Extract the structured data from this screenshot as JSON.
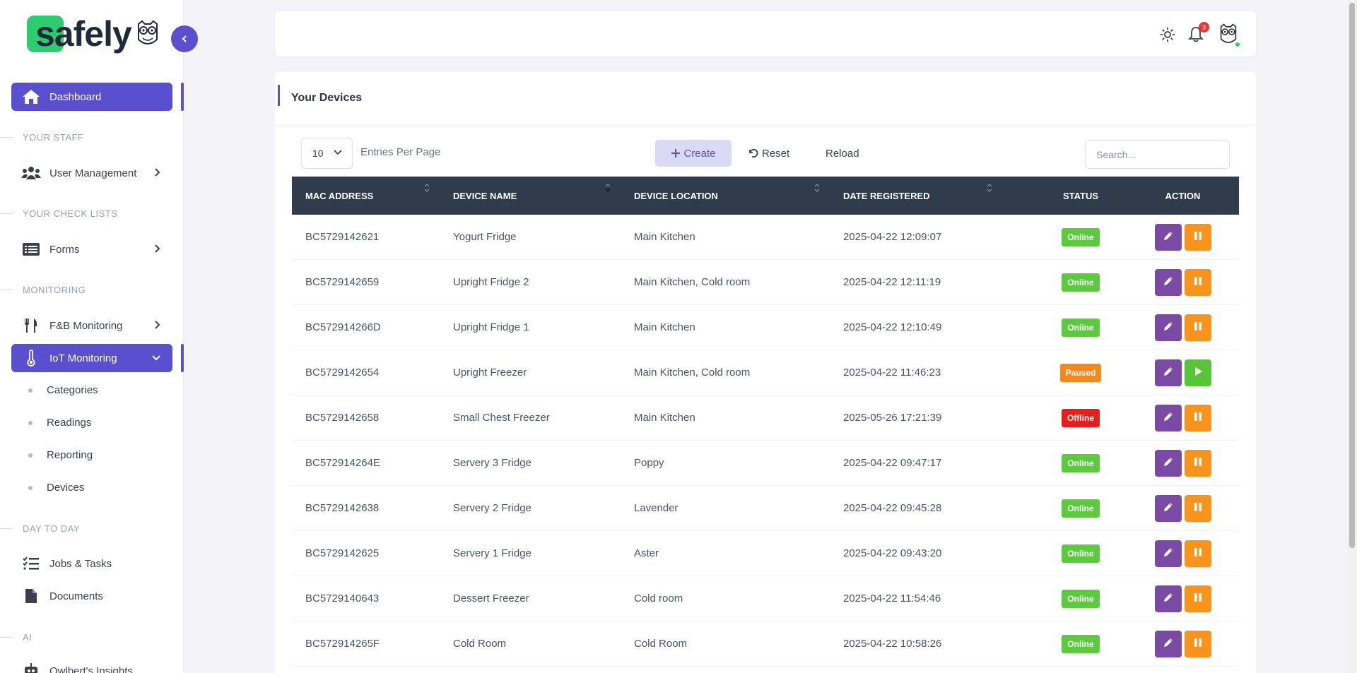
{
  "brand": {
    "name": "safely",
    "accent": "#5a4fcf",
    "logo_green": "#2ecc71"
  },
  "sidebar": {
    "dashboard": "Dashboard",
    "sections": {
      "staff": "YOUR STAFF",
      "checklists": "YOUR CHECK LISTS",
      "monitoring": "MONITORING",
      "daytoday": "DAY TO DAY",
      "ai": "AI"
    },
    "user_management": "User Management",
    "forms": "Forms",
    "fb_monitoring": "F&B Monitoring",
    "iot_monitoring": "IoT Monitoring",
    "iot_sub": [
      "Categories",
      "Readings",
      "Reporting",
      "Devices"
    ],
    "jobs_tasks": "Jobs & Tasks",
    "documents": "Documents",
    "insights": "Owlbert's Insights"
  },
  "topbar": {
    "notifications_count": "3"
  },
  "card": {
    "title": "Your Devices"
  },
  "toolbar": {
    "entries_value": "10",
    "entries_label": "Entries Per Page",
    "create_label": "Create",
    "reset_label": "Reset",
    "reload_label": "Reload",
    "search_placeholder": "Search..."
  },
  "table": {
    "headers": [
      "MAC ADDRESS",
      "DEVICE NAME",
      "DEVICE LOCATION",
      "DATE REGISTERED",
      "STATUS",
      "ACTION"
    ],
    "rows": [
      {
        "mac": "BC5729142621",
        "name": "Yogurt Fridge",
        "location": "Main Kitchen",
        "date": "2025-04-22 12:09:07",
        "status": "Online",
        "status_type": "online"
      },
      {
        "mac": "BC5729142659",
        "name": "Upright Fridge 2",
        "location": "Main Kitchen, Cold room",
        "date": "2025-04-22 12:11:19",
        "status": "Online",
        "status_type": "online"
      },
      {
        "mac": "BC572914266D",
        "name": "Upright Fridge 1",
        "location": "Main Kitchen",
        "date": "2025-04-22 12:10:49",
        "status": "Online",
        "status_type": "online"
      },
      {
        "mac": "BC5729142654",
        "name": "Upright Freezer",
        "location": "Main Kitchen, Cold room",
        "date": "2025-04-22 11:46:23",
        "status": "Paused",
        "status_type": "paused"
      },
      {
        "mac": "BC5729142658",
        "name": "Small Chest Freezer",
        "location": "Main Kitchen",
        "date": "2025-05-26 17:21:39",
        "status": "Offline",
        "status_type": "offline"
      },
      {
        "mac": "BC572914264E",
        "name": "Servery 3 Fridge",
        "location": "Poppy",
        "date": "2025-04-22 09:47:17",
        "status": "Online",
        "status_type": "online"
      },
      {
        "mac": "BC5729142638",
        "name": "Servery 2 Fridge",
        "location": "Lavender",
        "date": "2025-04-22 09:45:28",
        "status": "Online",
        "status_type": "online"
      },
      {
        "mac": "BC5729142625",
        "name": "Servery 1 Fridge",
        "location": "Aster",
        "date": "2025-04-22 09:43:20",
        "status": "Online",
        "status_type": "online"
      },
      {
        "mac": "BC5729140643",
        "name": "Dessert Freezer",
        "location": "Cold room",
        "date": "2025-04-22 11:54:46",
        "status": "Online",
        "status_type": "online"
      },
      {
        "mac": "BC572914265F",
        "name": "Cold Room",
        "location": "Cold Room",
        "date": "2025-04-22 10:58:26",
        "status": "Online",
        "status_type": "online"
      }
    ]
  },
  "colors": {
    "online": "#5cc93f",
    "paused": "#f5891f",
    "offline": "#e5201b",
    "edit": "#7b4aa4",
    "pause": "#f7941e",
    "play": "#57c43a",
    "header": "#2f3c4b"
  }
}
